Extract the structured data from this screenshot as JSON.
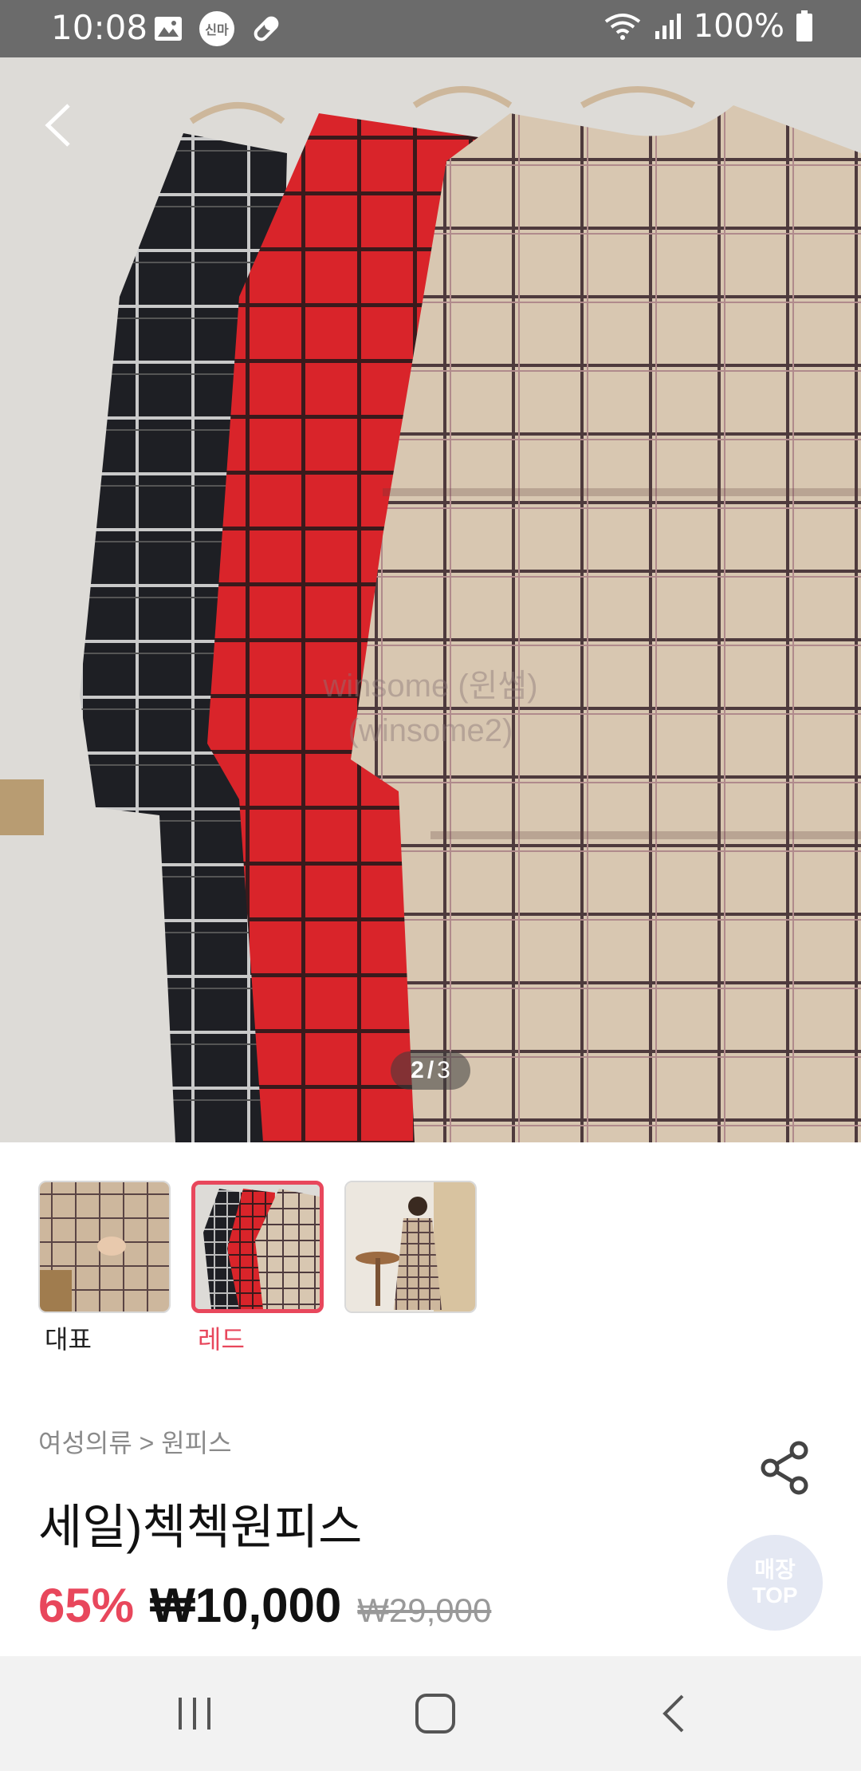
{
  "status_bar": {
    "time": "10:08",
    "battery": "100%",
    "notification_badge": "신마",
    "icons": [
      "image-icon",
      "badge-icon",
      "pill-icon",
      "wifi-icon",
      "signal-icon",
      "battery-icon"
    ]
  },
  "hero": {
    "watermark_line1": "winsome (윈썸)",
    "watermark_line2": "(winsome2)",
    "page_current": "2",
    "page_separator": "/",
    "page_total": "3"
  },
  "thumbnails": [
    {
      "label": "대표",
      "active": false
    },
    {
      "label": "레드",
      "active": true
    },
    {
      "label": "",
      "active": false
    }
  ],
  "product": {
    "breadcrumb": "여성의류 > 원피스",
    "title": "세일)첵첵원피스",
    "discount": "65%",
    "price": "₩10,000",
    "original_price": "₩29,000"
  },
  "top_button": {
    "line1": "매장",
    "line2": "TOP"
  },
  "colors": {
    "accent": "#e8475c",
    "status_bar": "#6b6b6b",
    "nav_bar": "#f2f2f2"
  }
}
